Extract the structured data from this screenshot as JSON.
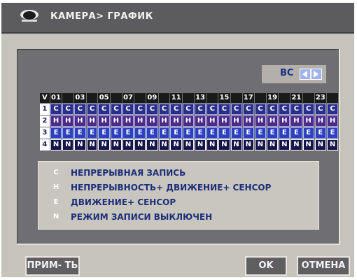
{
  "title": "КАМЕРА> ГРАФИК",
  "day": {
    "label": "ВС"
  },
  "grid": {
    "corner": "V",
    "hours": [
      "01",
      "",
      "03",
      "",
      "05",
      "",
      "07",
      "",
      "09",
      "",
      "11",
      "",
      "13",
      "",
      "15",
      "",
      "17",
      "",
      "19",
      "",
      "21",
      "",
      "23",
      ""
    ],
    "channels": [
      {
        "label": "1",
        "mode": "C"
      },
      {
        "label": "2",
        "mode": "H"
      },
      {
        "label": "3",
        "mode": "E"
      },
      {
        "label": "4",
        "mode": "N"
      }
    ]
  },
  "legend": [
    {
      "key": "C",
      "text": "НЕПРЕРЫВНАЯ ЗАПИСЬ"
    },
    {
      "key": "H",
      "text": "НЕПРЕРЫВНОСТЬ+ ДВИЖЕНИЕ+ СЕНСОР"
    },
    {
      "key": "E",
      "text": "ДВИЖЕНИЕ+ СЕНСОР"
    },
    {
      "key": "N",
      "text": "РЕЖИМ ЗАПИСИ ВЫКЛЮЧЕН"
    }
  ],
  "buttons": {
    "apply": "ПРИМ- ТЬ",
    "ok": "OK",
    "cancel": "ОТМЕНА"
  },
  "colors": {
    "titlebar": "#5c5c5f",
    "panel": "#6f6f73",
    "accent": "#1e2f7a",
    "button": "#5f5f61"
  }
}
